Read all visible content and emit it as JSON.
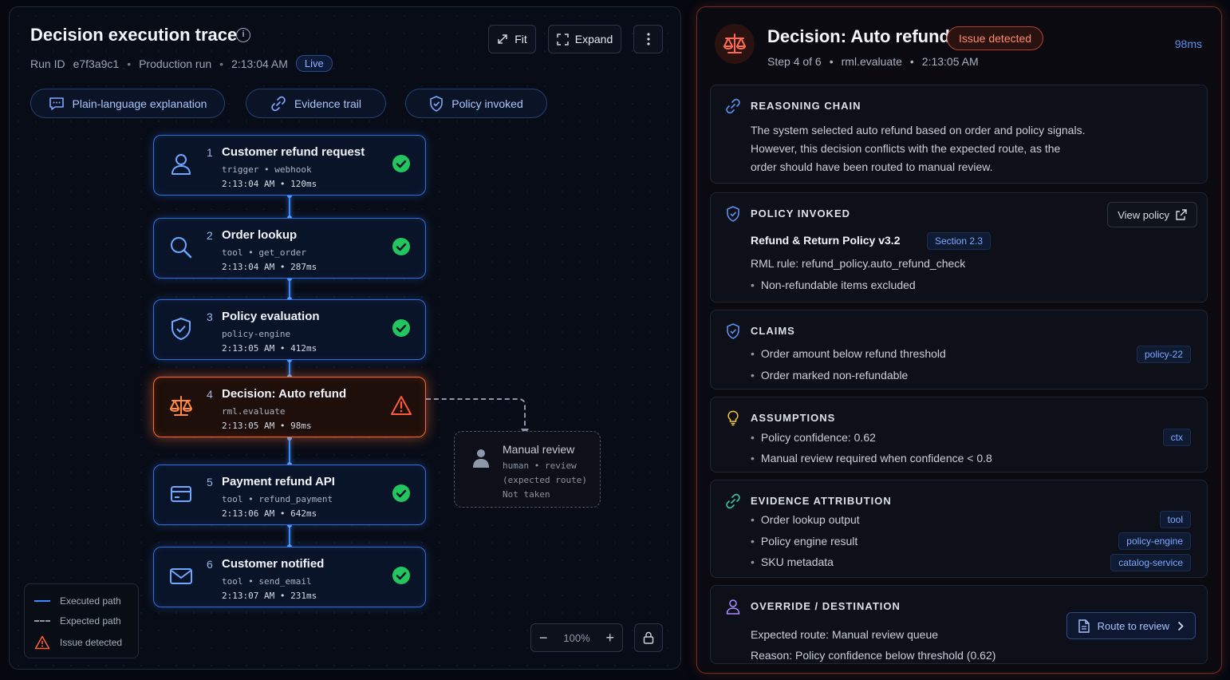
{
  "trace": {
    "title": "Decision execution trace",
    "run_label": "Run ID",
    "run_id": "e7f3a9c1",
    "run_type": "Production run",
    "time": "2:13:04 AM",
    "live": "Live",
    "toolbar": {
      "fit": "Fit",
      "expand": "Expand"
    },
    "pills": {
      "explanation": "Plain-language explanation",
      "evidence": "Evidence trail",
      "policy": "Policy invoked"
    },
    "nodes": [
      {
        "num": "1",
        "title": "Customer refund request",
        "sub": "trigger • webhook",
        "time": "2:13:04 AM  •  120ms",
        "icon": "user-icon",
        "status": "success"
      },
      {
        "num": "2",
        "title": "Order lookup",
        "sub": "tool • get_order",
        "time": "2:13:04 AM  •  287ms",
        "icon": "search-icon",
        "status": "success"
      },
      {
        "num": "3",
        "title": "Policy evaluation",
        "sub": "policy-engine",
        "time": "2:13:05 AM  •  412ms",
        "icon": "shield-icon",
        "status": "success"
      },
      {
        "num": "4",
        "title": "Decision: Auto refund",
        "sub": "rml.evaluate",
        "time": "2:13:05 AM  •  98ms",
        "icon": "scales-icon",
        "status": "issue"
      },
      {
        "num": "5",
        "title": "Payment refund API",
        "sub": "tool • refund_payment",
        "time": "2:13:06 AM  •  642ms",
        "icon": "credit-card-icon",
        "status": "success"
      },
      {
        "num": "6",
        "title": "Customer notified",
        "sub": "tool • send_email",
        "time": "2:13:07 AM  •  231ms",
        "icon": "mail-icon",
        "status": "success"
      }
    ],
    "manual_review": {
      "title": "Manual review",
      "line1": "human • review",
      "line2": "(expected route)",
      "line3": "Not taken"
    },
    "legend": {
      "executed": "Executed path",
      "expected": "Expected path",
      "issue": "Issue detected"
    },
    "zoom": "100%"
  },
  "detail": {
    "title": "Decision: Auto refund",
    "badge": "Issue detected",
    "latency": "98ms",
    "step": "Step 4 of 6",
    "fn": "rml.evaluate",
    "time": "2:13:05 AM",
    "reasoning": {
      "heading": "REASONING CHAIN",
      "line1": "The system selected auto refund based on order and policy signals.",
      "line2": "However, this decision conflicts with the expected route, as the",
      "line3": "order should have been routed to manual review."
    },
    "policy": {
      "heading": "POLICY INVOKED",
      "view": "View policy",
      "name": "Refund & Return Policy v3.2",
      "section": "Section 2.3",
      "rule": "RML rule: refund_policy.auto_refund_check",
      "bullet": "Non-refundable items excluded"
    },
    "claims": {
      "heading": "CLAIMS",
      "items": [
        "Order amount below refund threshold",
        "Order marked non-refundable"
      ],
      "tag": "policy-22"
    },
    "assumptions": {
      "heading": "ASSUMPTIONS",
      "items": [
        "Policy confidence: 0.62",
        "Manual review required when confidence < 0.8"
      ],
      "tag": "ctx"
    },
    "evidence": {
      "heading": "EVIDENCE ATTRIBUTION",
      "items": [
        "Order lookup output",
        "Policy engine result",
        "SKU metadata"
      ],
      "tags": [
        "tool",
        "policy-engine",
        "catalog-service"
      ]
    },
    "override": {
      "heading": "OVERRIDE / DESTINATION",
      "route": "Expected route: Manual review queue",
      "reason": "Reason: Policy confidence below threshold (0.62)",
      "button": "Route to review"
    }
  },
  "colors": {
    "accent_blue": "#3a8cff",
    "issue_orange": "#ff6a2b",
    "success_green": "#22c55e"
  }
}
